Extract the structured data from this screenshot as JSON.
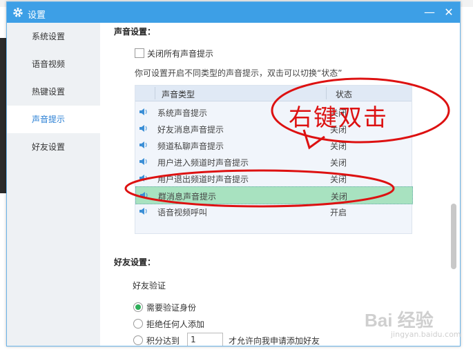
{
  "window": {
    "title": "设置",
    "minimize_label": "—",
    "close_label": "✕"
  },
  "sidebar": {
    "items": [
      {
        "label": "系统设置",
        "active": false
      },
      {
        "label": "语音视频",
        "active": false
      },
      {
        "label": "热键设置",
        "active": false
      },
      {
        "label": "声音提示",
        "active": true
      },
      {
        "label": "好友设置",
        "active": false
      }
    ]
  },
  "sound": {
    "section_title": "声音设置：",
    "mute_all_label": "关闭所有声音提示",
    "mute_all_checked": false,
    "hint": "你可设置开启不同类型的声音提示，双击可以切换“状态”",
    "columns": {
      "type": "声音类型",
      "state": "状态"
    },
    "rows": [
      {
        "name": "系统声音提示",
        "state": "关闭",
        "selected": false
      },
      {
        "name": "好友消息声音提示",
        "state": "关闭",
        "selected": false
      },
      {
        "name": "频道私聊声音提示",
        "state": "关闭",
        "selected": false
      },
      {
        "name": "用户进入频道时声音提示",
        "state": "关闭",
        "selected": false
      },
      {
        "name": "用户退出频道时声音提示",
        "state": "关闭",
        "selected": false
      },
      {
        "name": "群消息声音提示",
        "state": "关闭",
        "selected": true
      },
      {
        "name": "语音视频呼叫",
        "state": "开启",
        "selected": false
      }
    ]
  },
  "friend": {
    "section_title": "好友设置：",
    "verify_label": "好友验证",
    "options": [
      {
        "label": "需要验证身份",
        "checked": true
      },
      {
        "label": "拒绝任何人添加",
        "checked": false
      },
      {
        "label": "积分达到",
        "checked": false
      }
    ],
    "points_value": "1",
    "points_suffix": "才允许向我申请添加好友"
  },
  "annotation": {
    "text": "右键双击",
    "color": "#dd1111"
  },
  "watermark": {
    "text": "Bai 经验",
    "sub": "jingyan.baidu.com"
  }
}
